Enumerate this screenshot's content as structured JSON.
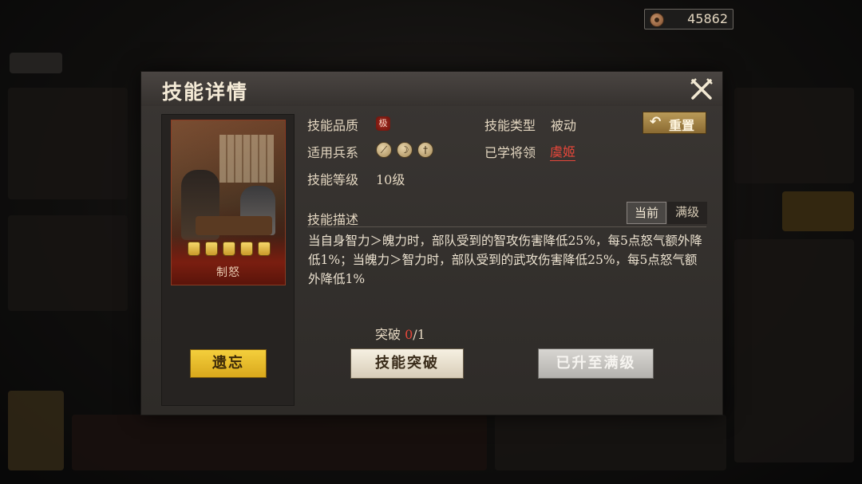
{
  "currency": {
    "icon": "coin-icon",
    "amount": "45862"
  },
  "dialog": {
    "title": "技能详情",
    "close_icon": "crossed-swords-close-icon"
  },
  "card": {
    "skill_name": "制怒",
    "level_tokens": 5
  },
  "info": {
    "quality_label": "技能品质",
    "quality_badge": "极",
    "type_label": "技能类型",
    "type_value": "被动",
    "troops_label": "适用兵系",
    "troop_icons": [
      "spear-icon",
      "bow-icon",
      "blade-icon"
    ],
    "learned_label": "已学将领",
    "learned_value": "虞姬",
    "level_label": "技能等级",
    "level_value": "10级",
    "reset_label": "重置"
  },
  "description": {
    "label": "技能描述",
    "tab_current": "当前",
    "tab_max": "满级",
    "text": "当自身智力＞魄力时，部队受到的智攻伤害降低25%，每5点怒气额外降低1%；当魄力＞智力时，部队受到的武攻伤害降低25%，每5点怒气额外降低1%"
  },
  "breakthrough": {
    "label": "突破",
    "current": "0",
    "max": "/1"
  },
  "buttons": {
    "forget": "遗忘",
    "breakthrough": "技能突破",
    "maxed": "已升至满级"
  }
}
